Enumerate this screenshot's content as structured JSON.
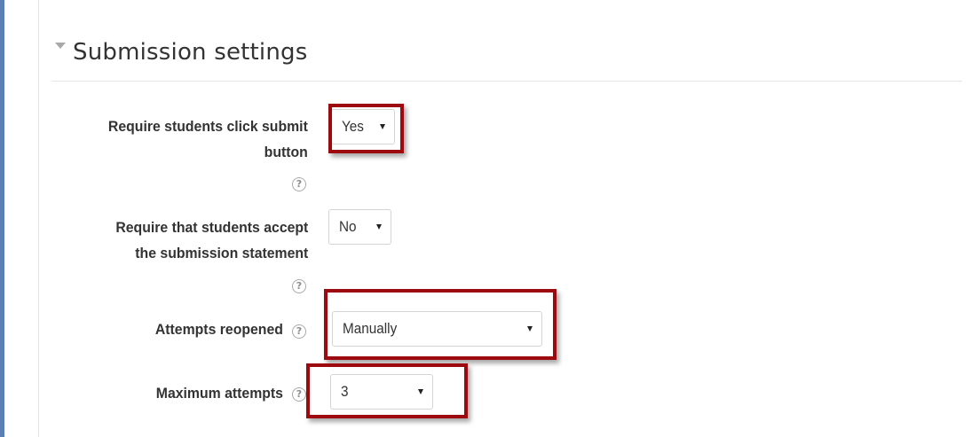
{
  "section": {
    "title": "Submission settings"
  },
  "help_glyph": "?",
  "icons": {
    "collapse": "caret-down-icon",
    "help": "help-question-icon",
    "dropdown": "dropdown-arrow-icon"
  },
  "colors": {
    "highlight_border": "#9c0a0f",
    "left_accent": "#5b7fb5"
  },
  "fields": {
    "require_submit": {
      "label_line1": "Require students click submit",
      "label_line2": "button",
      "value": "Yes"
    },
    "require_statement": {
      "label_line1": "Require that students accept",
      "label_line2": "the submission statement",
      "value": "No"
    },
    "attempts_reopened": {
      "label": "Attempts reopened",
      "value": "Manually"
    },
    "max_attempts": {
      "label": "Maximum attempts",
      "value": "3"
    }
  }
}
